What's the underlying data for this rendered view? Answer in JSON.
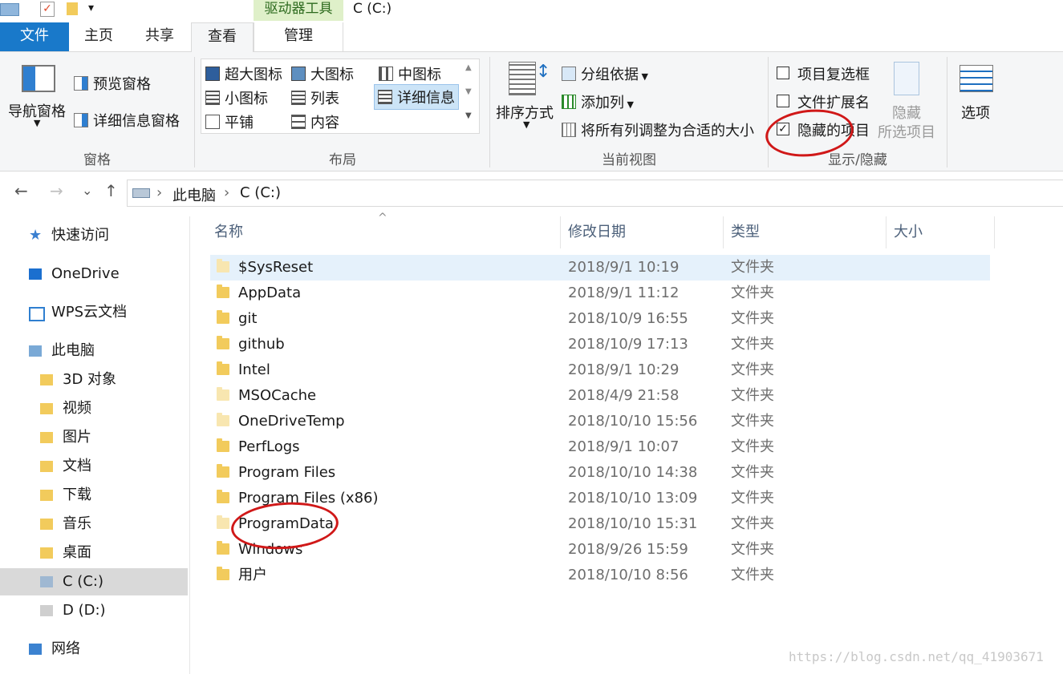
{
  "quick_access": {
    "customize_menu_glyph": "▾"
  },
  "context_tab": {
    "label": "驱动器工具"
  },
  "window": {
    "title": "C (C:)"
  },
  "tabs": {
    "file": "文件",
    "home": "主页",
    "share": "共享",
    "view": "查看",
    "manage": "管理"
  },
  "ribbon": {
    "panes": {
      "label": "窗格",
      "nav_pane": "导航窗格",
      "preview_pane": "预览窗格",
      "details_pane": "详细信息窗格"
    },
    "layout": {
      "label": "布局",
      "extra_large": "超大图标",
      "large": "大图标",
      "medium": "中图标",
      "small": "小图标",
      "list": "列表",
      "details": "详细信息",
      "tiles": "平铺",
      "content": "内容"
    },
    "current_view": {
      "label": "当前视图",
      "sort_by": "排序方式",
      "group_by": "分组依据",
      "add_columns": "添加列",
      "size_all_columns": "将所有列调整为合适的大小"
    },
    "show_hide": {
      "label": "显示/隐藏",
      "item_checkboxes": "项目复选框",
      "item_checkboxes_checked": false,
      "file_extensions": "文件扩展名",
      "file_extensions_checked": false,
      "hidden_items": "隐藏的项目",
      "hidden_items_checked": true,
      "hide_selected_1": "隐藏",
      "hide_selected_2": "所选项目"
    },
    "options": "选项"
  },
  "nav": {
    "back": "←",
    "forward": "→",
    "recent": "⌄",
    "up": "↑",
    "breadcrumb": [
      "此电脑",
      "C (C:)"
    ],
    "sort_arrow": "^"
  },
  "sidebar": {
    "items": [
      {
        "label": "快速访问",
        "icon": "star-icon"
      },
      {
        "label": "OneDrive",
        "icon": "cloud-icon"
      },
      {
        "label": "WPS云文档",
        "icon": "cloud-outline-icon"
      },
      {
        "label": "此电脑",
        "icon": "computer-icon"
      },
      {
        "label": "3D 对象",
        "icon": "folder-3d-icon"
      },
      {
        "label": "视频",
        "icon": "folder-video-icon"
      },
      {
        "label": "图片",
        "icon": "folder-pictures-icon"
      },
      {
        "label": "文档",
        "icon": "folder-documents-icon"
      },
      {
        "label": "下载",
        "icon": "folder-downloads-icon"
      },
      {
        "label": "音乐",
        "icon": "folder-music-icon"
      },
      {
        "label": "桌面",
        "icon": "folder-desktop-icon"
      },
      {
        "label": "C (C:)",
        "icon": "drive-c-icon",
        "selected": true
      },
      {
        "label": "D (D:)",
        "icon": "drive-d-icon"
      },
      {
        "label": "网络",
        "icon": "network-icon"
      }
    ]
  },
  "columns": {
    "name": "名称",
    "date": "修改日期",
    "type": "类型",
    "size": "大小"
  },
  "files": [
    {
      "name": "$SysReset",
      "date": "2018/9/1 10:19",
      "type": "文件夹",
      "hidden": true,
      "selected": true
    },
    {
      "name": "AppData",
      "date": "2018/9/1 11:12",
      "type": "文件夹"
    },
    {
      "name": "git",
      "date": "2018/10/9 16:55",
      "type": "文件夹"
    },
    {
      "name": "github",
      "date": "2018/10/9 17:13",
      "type": "文件夹"
    },
    {
      "name": "Intel",
      "date": "2018/9/1 10:29",
      "type": "文件夹"
    },
    {
      "name": "MSOCache",
      "date": "2018/4/9 21:58",
      "type": "文件夹",
      "hidden": true
    },
    {
      "name": "OneDriveTemp",
      "date": "2018/10/10 15:56",
      "type": "文件夹",
      "hidden": true
    },
    {
      "name": "PerfLogs",
      "date": "2018/9/1 10:07",
      "type": "文件夹"
    },
    {
      "name": "Program Files",
      "date": "2018/10/10 14:38",
      "type": "文件夹"
    },
    {
      "name": "Program Files (x86)",
      "date": "2018/10/10 13:09",
      "type": "文件夹"
    },
    {
      "name": "ProgramData",
      "date": "2018/10/10 15:31",
      "type": "文件夹",
      "hidden": true
    },
    {
      "name": "Windows",
      "date": "2018/9/26 15:59",
      "type": "文件夹"
    },
    {
      "name": "用户",
      "date": "2018/10/10 8:56",
      "type": "文件夹"
    }
  ],
  "watermark": "https://blog.csdn.net/qq_41903671",
  "colors": {
    "file_tab": "#1979ca",
    "context_tab": "#dff0c9",
    "selection": "#e5f1fb",
    "annotation": "#d01818",
    "folder": "#f2cb5c"
  }
}
